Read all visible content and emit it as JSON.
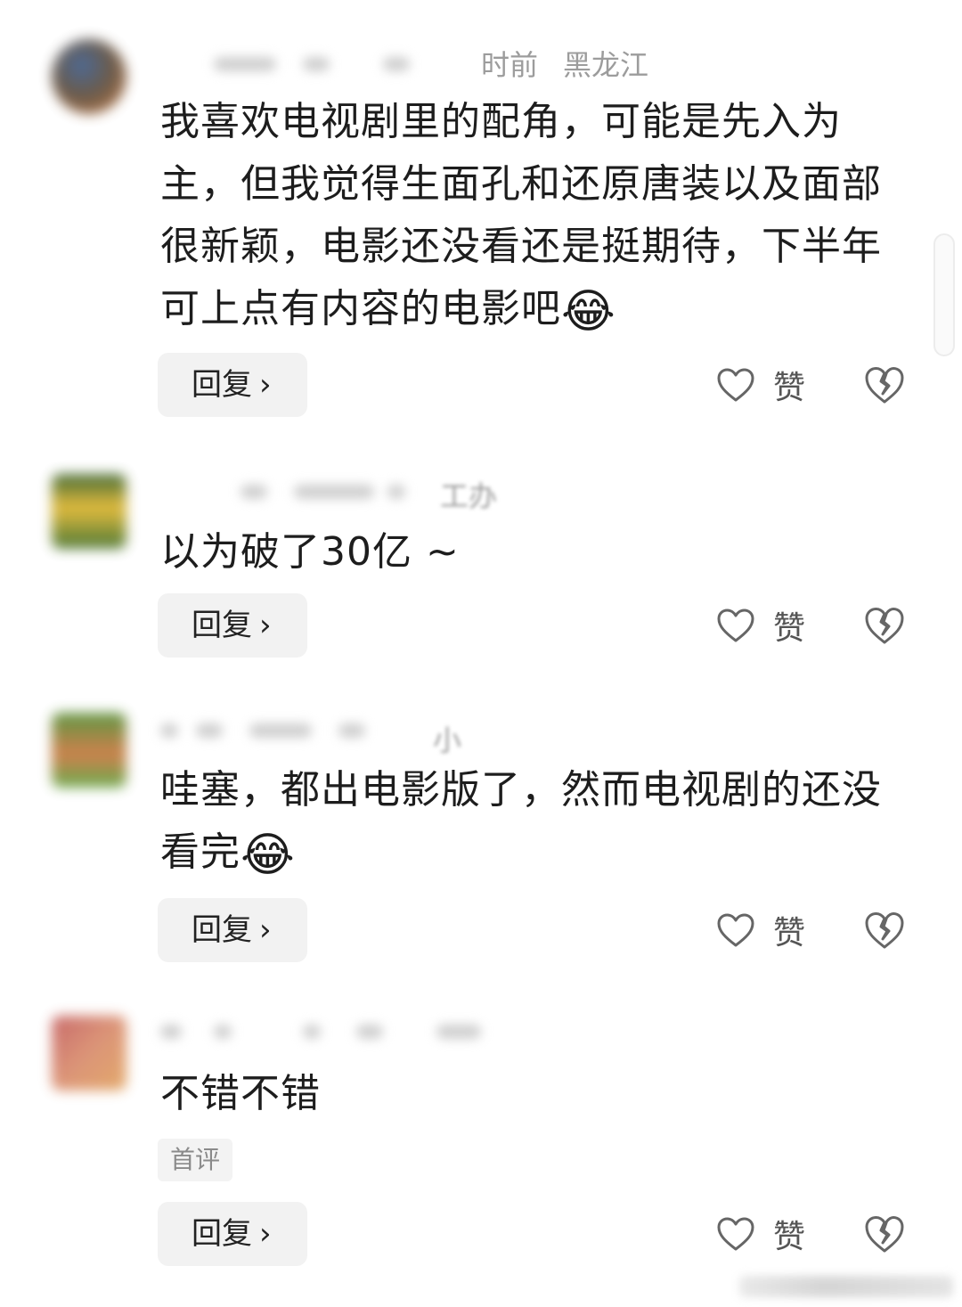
{
  "comments": [
    {
      "meta_right": "时前",
      "location": "黑龙江",
      "text": "我喜欢电视剧里的配角，可能是先入为主，但我觉得生面孔和还原唐装以及面部很新颖，电影还没看还是挺期待，下半年可上点有内容的电影吧",
      "emoji": "😂",
      "reply_label": "回复",
      "like_label": "赞",
      "avatar_colors": [
        "#3a5a8a",
        "#c26a2a"
      ]
    },
    {
      "meta_right": "工办",
      "text": "以为破了30亿 ~",
      "reply_label": "回复",
      "like_label": "赞",
      "avatar_colors": [
        "#2f5a1f",
        "#e0b52a"
      ]
    },
    {
      "meta_right": "小",
      "text": "哇塞，都出电影版了，然而电视剧的还没看完",
      "emoji": "😂",
      "reply_label": "回复",
      "like_label": "赞",
      "avatar_colors": [
        "#4e8a2e",
        "#c8743a"
      ]
    },
    {
      "text": "不错不错",
      "badge": "首评",
      "reply_label": "回复",
      "like_label": "赞",
      "avatar_colors": [
        "#c25a5a",
        "#e0a05a"
      ]
    }
  ],
  "icons": {
    "like": "heart-outline-icon",
    "dislike": "broken-heart-icon",
    "reply_chevron": "chevron-right-icon"
  },
  "colors": {
    "meta_text": "#9c9c9c",
    "button_bg": "#f2f2f2",
    "icon_stroke": "#666666"
  }
}
